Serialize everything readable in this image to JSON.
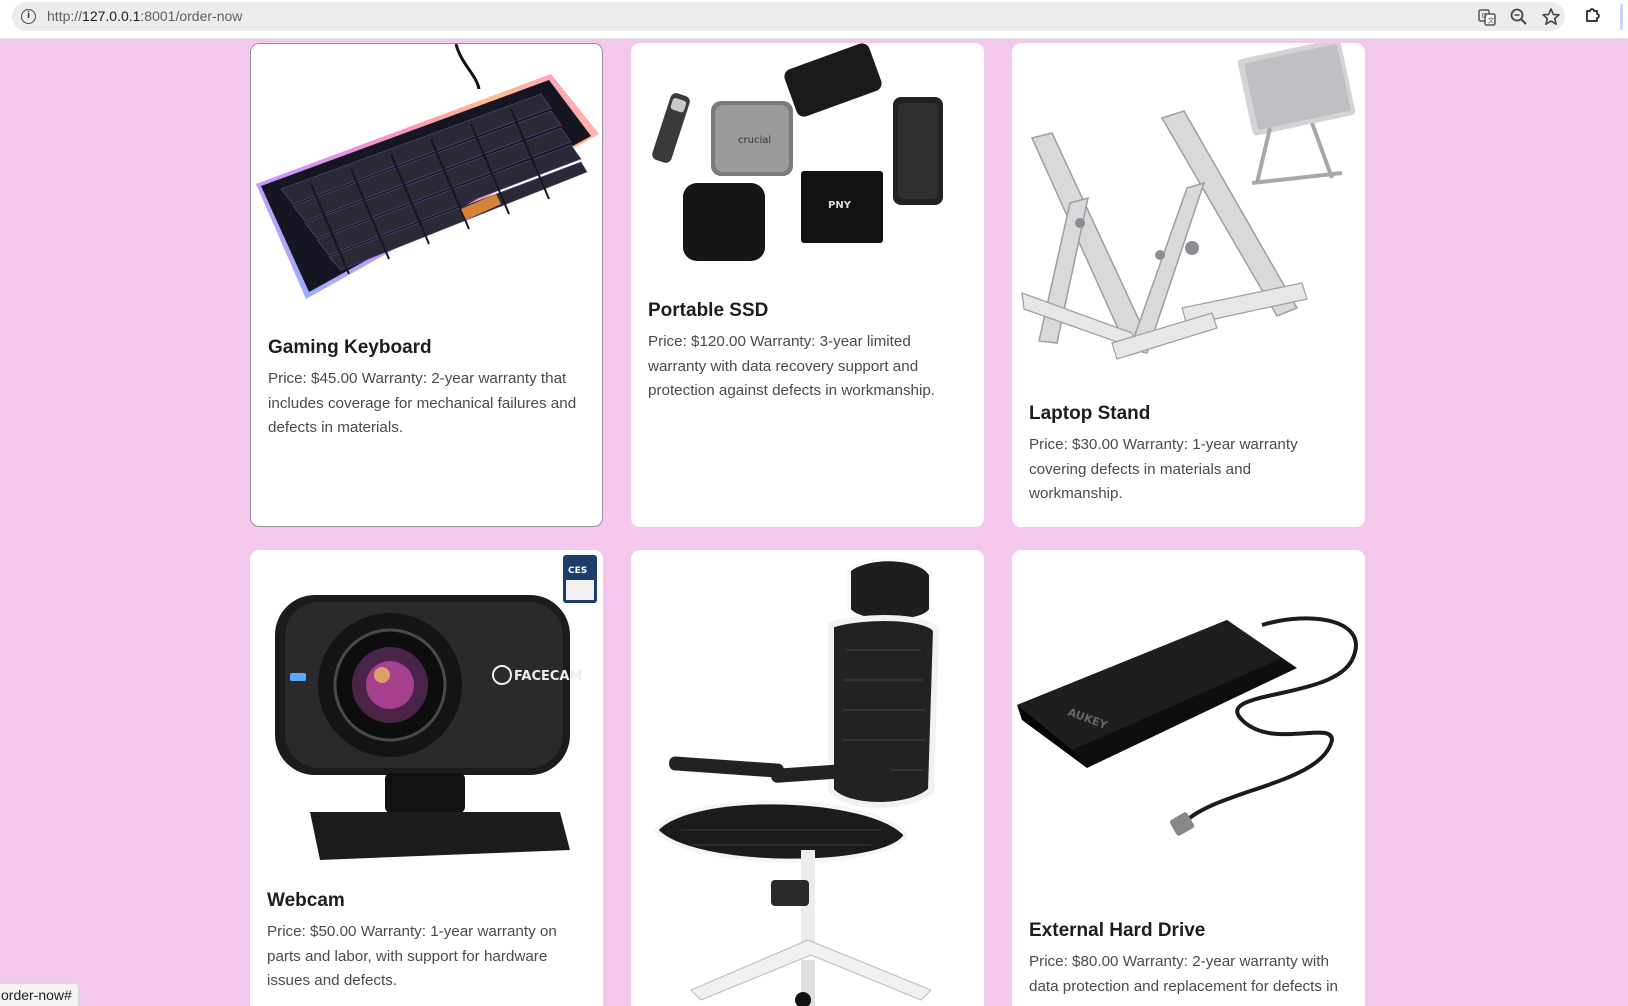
{
  "browser": {
    "url_prefix": "http://",
    "url_host": "127.0.0.1",
    "url_rest": ":8001/order-now",
    "icons": [
      "info-icon",
      "translate-icon",
      "zoom-icon",
      "bookmark-star-icon",
      "extensions-icon"
    ]
  },
  "products": [
    {
      "name": "Gaming Keyboard",
      "description": "Price: $45.00 Warranty: 2-year warranty that includes coverage for mechanical failures and defects in materials."
    },
    {
      "name": "Portable SSD",
      "description": "Price: $120.00 Warranty: 3-year limited warranty with data recovery support and protection against defects in workmanship."
    },
    {
      "name": "Laptop Stand",
      "description": "Price: $30.00 Warranty: 1-year warranty covering defects in materials and workmanship."
    },
    {
      "name": "Webcam",
      "description": "Price: $50.00 Warranty: 1-year warranty on parts and labor, with support for hardware issues and defects."
    },
    {
      "name": "",
      "description": ""
    },
    {
      "name": "External Hard Drive",
      "description": "Price: $80.00 Warranty: 2-year warranty with data protection and replacement for defects in"
    }
  ],
  "image_text": {
    "facecam": "FACECAM",
    "ces_badge": "CES",
    "aukey": "AUKEY",
    "pny": "PNY",
    "crucial": "crucial"
  },
  "status_bar": {
    "link": "order-now#"
  },
  "colors": {
    "page_background": "#f4c8ec",
    "card_background": "#ffffff"
  }
}
